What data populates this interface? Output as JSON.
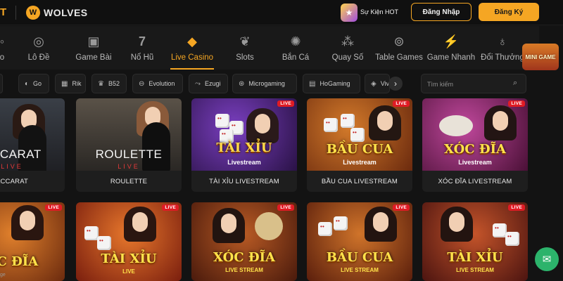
{
  "header": {
    "brand_left": "T",
    "brand_name": "WOLVES",
    "event_label": "Sự Kiện HOT",
    "login_label": "Đăng Nhập",
    "register_label": "Đăng Ký"
  },
  "categories": [
    {
      "label": "Lô Đề",
      "icon": "dartboard-icon"
    },
    {
      "label": "Game Bài",
      "icon": "cards-icon"
    },
    {
      "label": "Nổ Hũ",
      "icon": "seven-icon"
    },
    {
      "label": "Live Casino",
      "icon": "diamond-icon",
      "active": true
    },
    {
      "label": "Slots",
      "icon": "cherry-icon"
    },
    {
      "label": "Bắn Cá",
      "icon": "fish-icon"
    },
    {
      "label": "Quay Số",
      "icon": "lottery-balls-icon"
    },
    {
      "label": "Table Games",
      "icon": "chips-icon"
    },
    {
      "label": "Game Nhanh",
      "icon": "lightning-icon"
    },
    {
      "label": "Đổi Thưởng",
      "icon": "money-bag-icon"
    }
  ],
  "mini_game_label": "MINI GAME",
  "providers": [
    {
      "label": "Go"
    },
    {
      "label": "Rik"
    },
    {
      "label": "B52"
    },
    {
      "label": "Evolution"
    },
    {
      "label": "Ezugi"
    },
    {
      "label": "Microgaming"
    },
    {
      "label": "HoGaming"
    },
    {
      "label": "Vivo"
    }
  ],
  "search": {
    "placeholder": "Tìm kiếm"
  },
  "live_badge": "LIVE",
  "games_row1": [
    {
      "title": "ACCARAT",
      "thumb_title": "ACCARAT",
      "thumb_sub": "LIVE"
    },
    {
      "title": "ROULETTE",
      "thumb_title": "ROULETTE",
      "thumb_sub": "LIVE"
    },
    {
      "title": "TÀI XỈU LIVESTREAM",
      "thumb_title": "TÀI XỈU",
      "thumb_sub": "Livestream"
    },
    {
      "title": "BẦU CUA LIVESTREAM",
      "thumb_title": "BẦU CUA",
      "thumb_sub": "Livestream"
    },
    {
      "title": "XÓC ĐĨA LIVESTREAM",
      "thumb_title": "XÓC ĐĨA",
      "thumb_sub": "Livestream"
    }
  ],
  "games_row2": [
    {
      "thumb_title": "ỐC ĐĨA",
      "thumb_sub": ""
    },
    {
      "thumb_title": "TÀI XỈU",
      "thumb_sub": "LIVE"
    },
    {
      "thumb_title": "XÓC ĐĨA",
      "thumb_sub": "LIVE STREAM"
    },
    {
      "thumb_title": "BẦU CUA",
      "thumb_sub": "LIVE STREAM"
    },
    {
      "thumb_title": "TÀI XỈU",
      "thumb_sub": "LIVE STREAM"
    }
  ],
  "bottom_left_text": "ge",
  "colors": {
    "accent": "#f5a623",
    "live": "#e01b24",
    "chat": "#2cb36b"
  }
}
